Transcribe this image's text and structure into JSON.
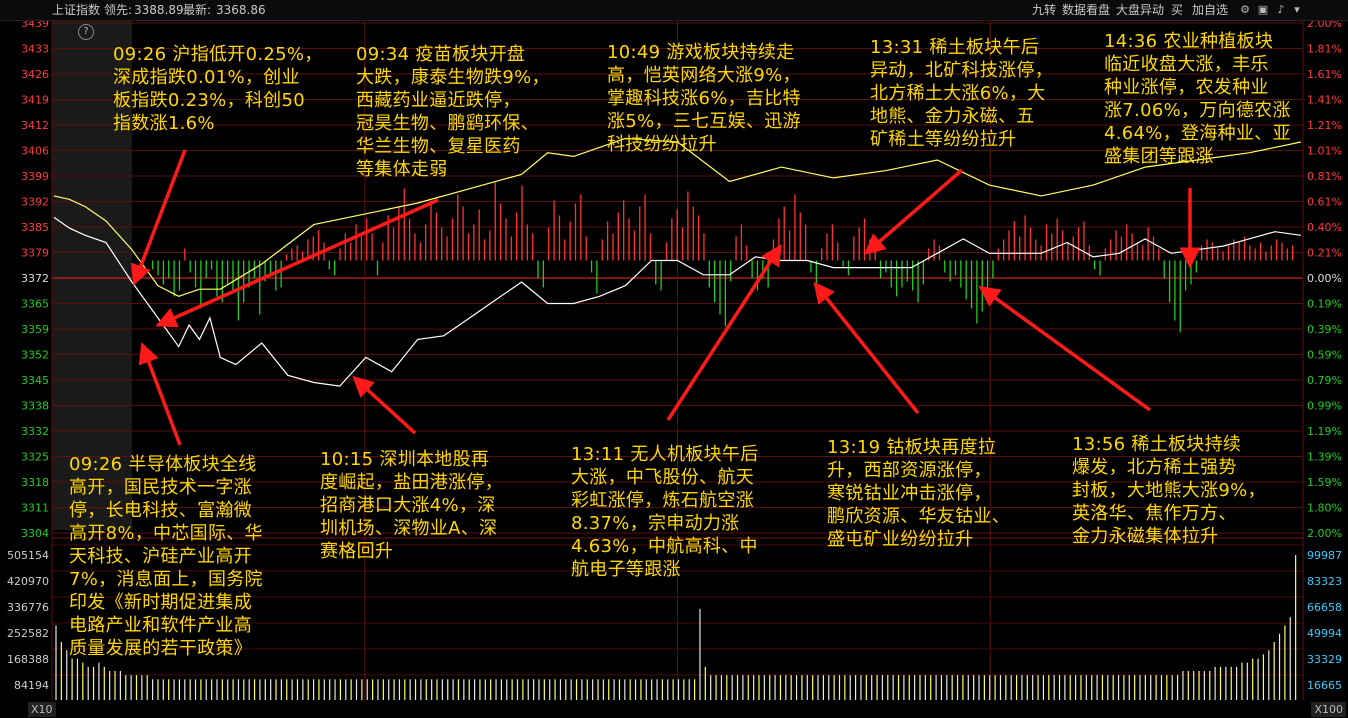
{
  "header": {
    "index_name": "上证指数",
    "lead_label": "领先:",
    "lead_value": "3388.89",
    "latest_label": "最新:",
    "latest_value": "3368.86",
    "buttons": [
      "九转",
      "数据看盘",
      "大盘异动",
      "买",
      "加自选"
    ],
    "icons": [
      "help-icon",
      "settings-icon",
      "lock-icon",
      "bell-icon",
      "dropdown-icon"
    ]
  },
  "chart_data": {
    "type": "line",
    "title": "",
    "xlabel": "",
    "ylabel": "",
    "prev_close": 3372,
    "ylim": [
      3300,
      3440
    ],
    "price_axis_left": [
      "3439",
      "3433",
      "3426",
      "3419",
      "3412",
      "3406",
      "3399",
      "3392",
      "3385",
      "3379",
      "3372",
      "3365",
      "3359",
      "3352",
      "3345",
      "3338",
      "3332",
      "3325",
      "3318",
      "3311",
      "3304"
    ],
    "pct_axis_right": [
      "2.00%",
      "1.81%",
      "1.61%",
      "1.41%",
      "1.21%",
      "1.01%",
      "0.81%",
      "0.61%",
      "0.40%",
      "0.21%",
      "0.00%",
      "0.19%",
      "0.39%",
      "0.59%",
      "0.79%",
      "0.99%",
      "1.19%",
      "1.39%",
      "1.59%",
      "1.80%",
      "2.00%"
    ],
    "volume_axis_left": [
      "505154",
      "420970",
      "336776",
      "252582",
      "168388",
      "84194"
    ],
    "volume_axis_right": [
      "99987",
      "83323",
      "66658",
      "49994",
      "33329",
      "16665"
    ],
    "left_badge": "X10",
    "right_badge": "X100",
    "series": [
      {
        "role": "index",
        "color": "#ffffff",
        "x": [
          0,
          3,
          6,
          10,
          15,
          20,
          24,
          26,
          28,
          30,
          32,
          35,
          40,
          45,
          50,
          55,
          60,
          65,
          70,
          75,
          80,
          85,
          90,
          95,
          100,
          105,
          110,
          115,
          120,
          125,
          130,
          135,
          140,
          145,
          150,
          155,
          160,
          165,
          170,
          175,
          180,
          185,
          190,
          195,
          200,
          205,
          210,
          215,
          220,
          225,
          230,
          235,
          240
        ],
        "values": [
          3384,
          3381,
          3379,
          3377,
          3366,
          3356,
          3348,
          3354,
          3350,
          3356,
          3345,
          3343,
          3349,
          3340,
          3338,
          3337,
          3345,
          3341,
          3350,
          3351,
          3356,
          3361,
          3366,
          3360,
          3360,
          3362,
          3365,
          3372,
          3372,
          3368,
          3368,
          3373,
          3372,
          3372,
          3370,
          3370,
          3370,
          3370,
          3374,
          3378,
          3374,
          3374,
          3374,
          3377,
          3373,
          3374,
          3378,
          3374,
          3375,
          3376,
          3378,
          3380,
          3379
        ]
      },
      {
        "role": "average",
        "color": "#ffff66",
        "x": [
          0,
          3,
          6,
          10,
          15,
          20,
          24,
          28,
          32,
          40,
          50,
          60,
          70,
          80,
          90,
          95,
          100,
          110,
          120,
          130,
          140,
          150,
          160,
          170,
          180,
          190,
          200,
          210,
          220,
          230,
          240
        ],
        "values": [
          3390,
          3389,
          3387,
          3383,
          3375,
          3365,
          3362,
          3364,
          3364,
          3371,
          3382,
          3385,
          3388,
          3392,
          3396,
          3402,
          3401,
          3406,
          3405,
          3394,
          3398,
          3395,
          3397,
          3400,
          3393,
          3390,
          3393,
          3398,
          3400,
          3402,
          3405
        ]
      }
    ],
    "flow_bars": [
      0,
      0,
      -3,
      -5,
      -8,
      -6,
      -12,
      -10,
      4,
      -4,
      -9,
      -16,
      -6,
      -3,
      -12,
      -14,
      -8,
      -10,
      -20,
      -14,
      -9,
      -6,
      -18,
      -7,
      -5,
      -10,
      -9,
      2,
      4,
      5,
      3,
      7,
      8,
      10,
      6,
      -3,
      -5,
      4,
      9,
      6,
      12,
      8,
      14,
      9,
      -5,
      6,
      15,
      11,
      18,
      24,
      14,
      9,
      6,
      12,
      20,
      16,
      11,
      8,
      14,
      22,
      18,
      9,
      12,
      17,
      7,
      10,
      26,
      19,
      14,
      8,
      16,
      25,
      12,
      9,
      -6,
      -9,
      11,
      20,
      15,
      7,
      13,
      19,
      22,
      8,
      -4,
      -11,
      7,
      13,
      9,
      16,
      20,
      14,
      10,
      18,
      22,
      9,
      -8,
      -10,
      6,
      14,
      17,
      11,
      23,
      18,
      15,
      9,
      -9,
      -14,
      -18,
      -22,
      -7,
      8,
      12,
      5,
      -6,
      -10,
      -6,
      -9,
      7,
      14,
      18,
      10,
      22,
      16,
      12,
      -4,
      -8,
      4,
      9,
      12,
      6,
      -2,
      -5,
      8,
      11,
      14,
      7,
      4,
      -6,
      -4,
      -9,
      -12,
      -9,
      -7,
      -10,
      -14,
      -8,
      4,
      7,
      5,
      -4,
      -7,
      -5,
      -9,
      -13,
      -16,
      -21,
      -17,
      -12,
      -6,
      4,
      7,
      10,
      13,
      8,
      15,
      11,
      7,
      5,
      12,
      9,
      14,
      10,
      6,
      8,
      11,
      13,
      5,
      -3,
      -5,
      4,
      7,
      10,
      8,
      12,
      9,
      6,
      5,
      11,
      8,
      4,
      -6,
      -14,
      -20,
      -24,
      -10,
      -8,
      -4,
      5,
      7,
      6,
      4,
      3,
      5,
      7,
      6,
      8,
      5,
      4,
      6,
      3,
      5,
      7,
      6,
      4,
      5
    ],
    "volume_bars": [
      18,
      14,
      12,
      10,
      10,
      9,
      8,
      8,
      9,
      8,
      7,
      7,
      7,
      6,
      6,
      6,
      6,
      6,
      5,
      5,
      5,
      5,
      5,
      5,
      5,
      5,
      5,
      5,
      5,
      5,
      5,
      5,
      5,
      5,
      5,
      5,
      5,
      5,
      5,
      5,
      5,
      5,
      5,
      5,
      5,
      5,
      5,
      5,
      5,
      5,
      5,
      5,
      5,
      5,
      5,
      5,
      5,
      5,
      5,
      5,
      5,
      5,
      5,
      5,
      5,
      5,
      5,
      5,
      5,
      5,
      5,
      5,
      5,
      5,
      5,
      5,
      5,
      5,
      5,
      5,
      5,
      5,
      5,
      5,
      5,
      5,
      5,
      5,
      5,
      5,
      5,
      5,
      5,
      5,
      5,
      5,
      5,
      5,
      5,
      5,
      5,
      5,
      5,
      5,
      5,
      5,
      5,
      5,
      5,
      5,
      5,
      5,
      5,
      5,
      5,
      5,
      5,
      5,
      5,
      5,
      22,
      8,
      6,
      6,
      6,
      6,
      6,
      6,
      6,
      6,
      6,
      6,
      6,
      6,
      6,
      6,
      6,
      6,
      6,
      6,
      6,
      6,
      6,
      6,
      6,
      6,
      6,
      6,
      6,
      6,
      6,
      6,
      6,
      6,
      6,
      6,
      6,
      6,
      6,
      6,
      6,
      6,
      6,
      6,
      6,
      6,
      6,
      6,
      6,
      6,
      6,
      6,
      6,
      6,
      6,
      6,
      6,
      6,
      6,
      6,
      6,
      6,
      6,
      6,
      6,
      6,
      6,
      6,
      6,
      6,
      6,
      6,
      6,
      6,
      6,
      6,
      6,
      6,
      6,
      6,
      6,
      6,
      6,
      6,
      6,
      6,
      6,
      6,
      6,
      6,
      7,
      7,
      7,
      7,
      7,
      7,
      8,
      8,
      8,
      8,
      8,
      9,
      9,
      10,
      10,
      11,
      12,
      14,
      16,
      18,
      20,
      35
    ],
    "annotations": [
      {
        "text": "09:26 沪指低开0.25%，\n深成指跌0.01%，创业\n板指跌0.23%，科创50\n指数涨1.6%"
      },
      {
        "text": "09:34 疫苗板块开盘\n大跌，康泰生物跌9%，\n西藏药业逼近跌停，\n冠昊生物、鹏鹞环保、\n华兰生物、复星医药\n等集体走弱"
      },
      {
        "text": "10:49 游戏板块持续走\n高，恺英网络大涨9%，\n掌趣科技涨6%，吉比特\n涨5%，三七互娱、迅游\n科技纷纷拉升"
      },
      {
        "text": "13:31 稀土板块午后\n异动，北矿科技涨停，\n北方稀土大涨6%，大\n地熊、金力永磁、五\n矿稀土等纷纷拉升"
      },
      {
        "text": "14:36 农业种植板块\n临近收盘大涨，丰乐\n种业涨停，农发种业\n涨7.06%，万向德农涨\n4.64%，登海种业、亚\n盛集团等跟涨"
      },
      {
        "text": "09:26 半导体板块全线\n高开，国民技术一字涨\n停，长电科技、富瀚微\n高开8%，中芯国际、华\n天科技、沪硅产业高开\n7%，消息面上，国务院\n印发《新时期促进集成\n电路产业和软件产业高\n质量发展的若干政策》"
      },
      {
        "text": "10:15 深圳本地股再\n度崛起，盐田港涨停，\n招商港口大涨4%，深\n圳机场、深物业A、深\n赛格回升"
      },
      {
        "text": "13:11 无人机板块午后\n大涨，中飞股份、航天\n彩虹涨停，炼石航空涨\n8.37%，宗申动力涨\n4.63%，中航高科、中\n航电子等跟涨"
      },
      {
        "text": "13:19 钴板块再度拉\n升，西部资源涨停，\n寒锐钴业冲击涨停，\n鹏欣资源、华友钴业、\n盛屯矿业纷纷拉升"
      },
      {
        "text": "13:56 稀土板块持续\n爆发，北方稀土强势\n封板，大地熊大涨9%，\n英洛华、焦作万方、\n金力永磁集体拉升"
      }
    ]
  }
}
